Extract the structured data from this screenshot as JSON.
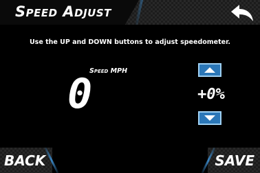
{
  "header": {
    "title": "Speed Adjust"
  },
  "instruction": "Use the UP and DOWN buttons to adjust speedometer.",
  "speed": {
    "label": "Speed MPH",
    "value": "0"
  },
  "adjustment": {
    "percent": "+0%"
  },
  "footer": {
    "back_label": "BACK",
    "save_label": "SAVE"
  },
  "colors": {
    "accent": "#2b77b8",
    "accent_border": "#9ed0f3"
  }
}
